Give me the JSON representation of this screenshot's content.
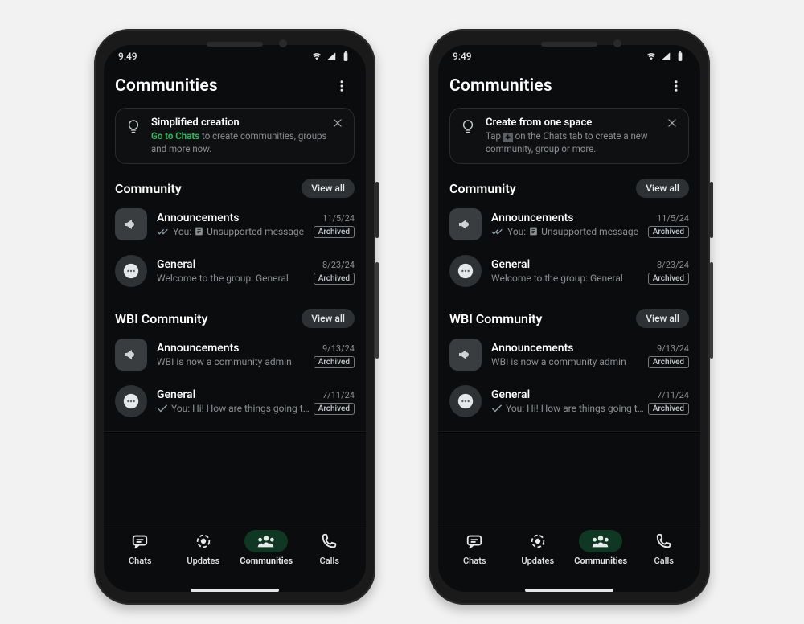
{
  "statusbar": {
    "time": "9:49"
  },
  "screen_title": "Communities",
  "phones": [
    {
      "tip": {
        "title": "Simplified creation",
        "accent": "Go to Chats",
        "text_rest": " to create communities, groups and more now.",
        "mode": "accent"
      }
    },
    {
      "tip": {
        "title": "Create from one space",
        "text_pre": "Tap ",
        "text_post": " on the Chats tab to create a new community, group or more.",
        "mode": "chip"
      }
    }
  ],
  "communities": [
    {
      "name": "Community",
      "view_all": "View all",
      "chats": [
        {
          "kind": "announcements",
          "name": "Announcements",
          "date": "11/5/24",
          "prefix": "You:",
          "msg": "Unsupported message",
          "ticks": true,
          "doc_icon": true,
          "tag": "Archived"
        },
        {
          "kind": "general",
          "name": "General",
          "date": "8/23/24",
          "msg": "Welcome to the group: General",
          "tag": "Archived"
        }
      ]
    },
    {
      "name": "WBI Community",
      "view_all": "View all",
      "chats": [
        {
          "kind": "announcements",
          "name": "Announcements",
          "date": "9/13/24",
          "msg": "WBI is now a community admin",
          "tag": "Archived"
        },
        {
          "kind": "general",
          "name": "General",
          "date": "7/11/24",
          "prefix": "You:",
          "msg": "Hi! How are things going t…",
          "single_tick": true,
          "tag": "Archived"
        }
      ]
    }
  ],
  "nav": {
    "items": [
      {
        "id": "chats",
        "label": "Chats"
      },
      {
        "id": "updates",
        "label": "Updates"
      },
      {
        "id": "communities",
        "label": "Communities",
        "active": true
      },
      {
        "id": "calls",
        "label": "Calls"
      }
    ]
  }
}
